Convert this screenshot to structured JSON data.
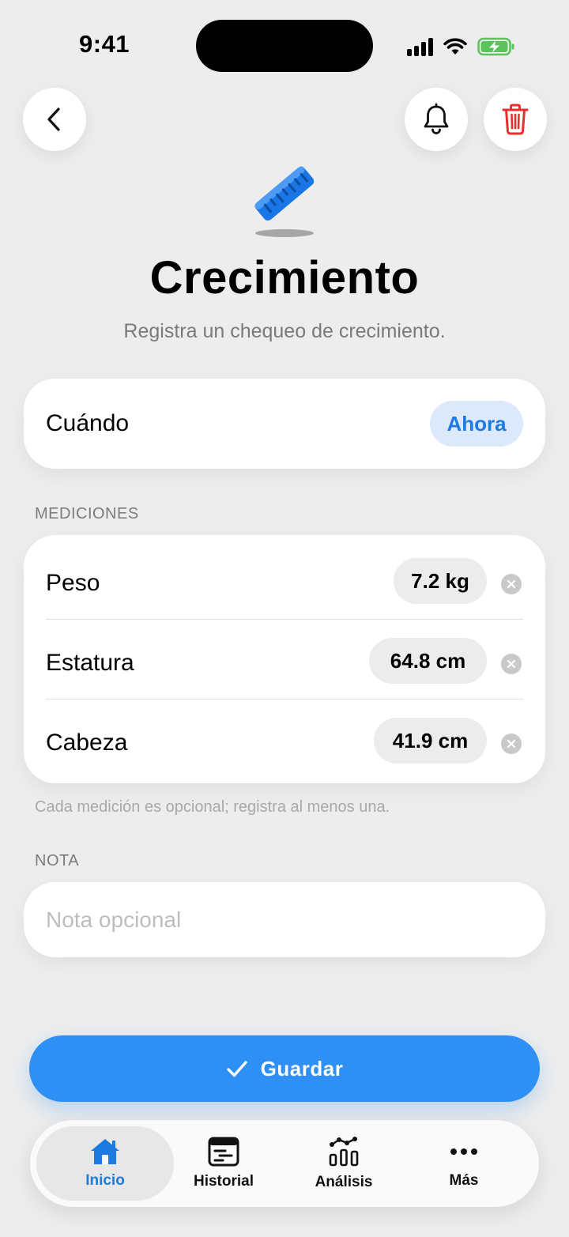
{
  "status_bar": {
    "time": "9:41"
  },
  "header": {
    "title": "Crecimiento",
    "subtitle": "Registra un chequeo de crecimiento."
  },
  "when": {
    "label": "Cuándo",
    "value": "Ahora"
  },
  "measurements": {
    "section_label": "MEDICIONES",
    "items": [
      {
        "label": "Peso",
        "value": "7.2 kg"
      },
      {
        "label": "Estatura",
        "value": "64.8 cm"
      },
      {
        "label": "Cabeza",
        "value": "41.9 cm"
      }
    ],
    "hint": "Cada medición es opcional; registra al menos una."
  },
  "note": {
    "section_label": "NOTA",
    "placeholder": "Nota opcional",
    "value": ""
  },
  "save_button": {
    "label": "Guardar"
  },
  "tabs": [
    {
      "label": "Inicio",
      "icon": "home-icon",
      "active": true
    },
    {
      "label": "Historial",
      "icon": "history-icon",
      "active": false
    },
    {
      "label": "Análisis",
      "icon": "analytics-icon",
      "active": false
    },
    {
      "label": "Más",
      "icon": "more-icon",
      "active": false
    }
  ],
  "colors": {
    "accent": "#2e8ff5",
    "accent_text": "#1d7ae0",
    "delete": "#e5302b",
    "background": "#ededed"
  }
}
